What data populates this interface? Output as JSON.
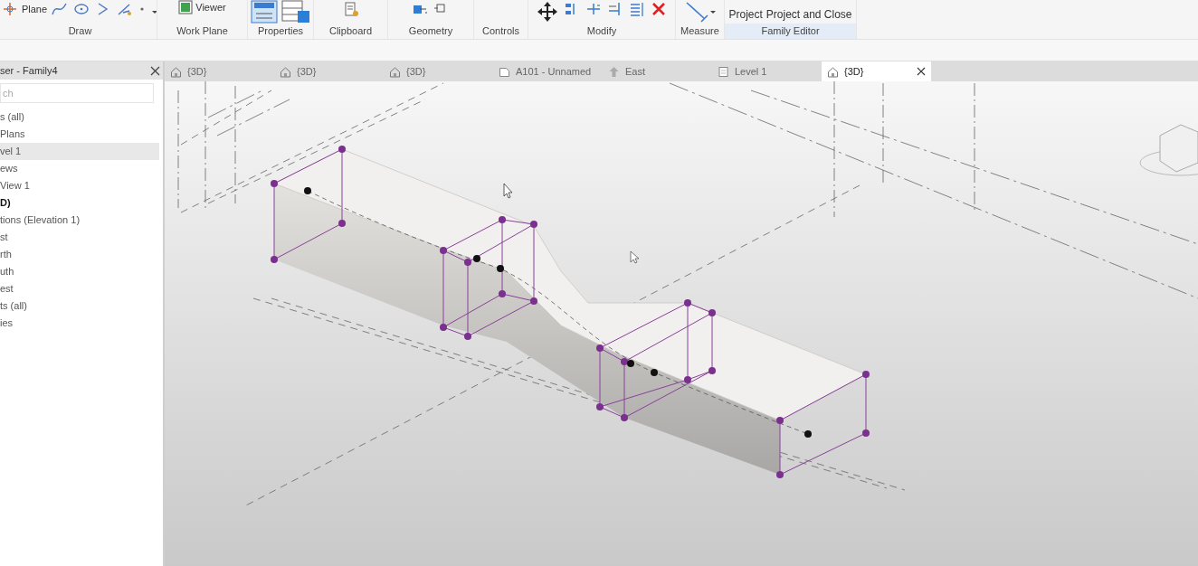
{
  "ribbon": {
    "groups": [
      {
        "label": "Draw",
        "tools": [
          {
            "kind": "plane",
            "label": "Plane"
          },
          {
            "kind": "spline"
          },
          {
            "kind": "ellipse"
          },
          {
            "kind": "arc"
          },
          {
            "kind": "pick"
          },
          {
            "kind": "point"
          },
          {
            "kind": "more"
          }
        ]
      },
      {
        "label": "Work Plane",
        "tools": [
          {
            "kind": "viewer",
            "label": "Viewer"
          }
        ]
      },
      {
        "label": "Properties",
        "tools": [
          {
            "kind": "properties"
          },
          {
            "kind": "types"
          }
        ]
      },
      {
        "label": "Clipboard",
        "tools": [
          {
            "kind": "match"
          }
        ]
      },
      {
        "label": "Geometry",
        "tools": [
          {
            "kind": "join"
          },
          {
            "kind": "cut"
          }
        ]
      },
      {
        "label": "Controls"
      },
      {
        "label": "Modify",
        "tools": [
          {
            "kind": "move"
          },
          {
            "kind": "align"
          },
          {
            "kind": "split"
          },
          {
            "kind": "trim"
          },
          {
            "kind": "array"
          },
          {
            "kind": "delete"
          }
        ]
      },
      {
        "label": "Measure",
        "tools": [
          {
            "kind": "measure"
          }
        ]
      },
      {
        "label": "Family Editor",
        "tools": [
          {
            "kind": "text",
            "label": "Project"
          },
          {
            "kind": "text",
            "label": "Project and Close"
          }
        ]
      }
    ]
  },
  "browser": {
    "title": "ser - Family4",
    "search": {
      "placeholder": "ch"
    },
    "items": [
      {
        "label": "s (all)",
        "selected": false,
        "bold": false
      },
      {
        "label": "Plans",
        "selected": false,
        "bold": false
      },
      {
        "label": "vel 1",
        "selected": true,
        "bold": false
      },
      {
        "label": "ews",
        "selected": false,
        "bold": false
      },
      {
        "label": "View 1",
        "selected": false,
        "bold": false
      },
      {
        "label": "D)",
        "selected": false,
        "bold": true
      },
      {
        "label": "tions (Elevation 1)",
        "selected": false,
        "bold": false
      },
      {
        "label": "st",
        "selected": false,
        "bold": false
      },
      {
        "label": "rth",
        "selected": false,
        "bold": false
      },
      {
        "label": "uth",
        "selected": false,
        "bold": false
      },
      {
        "label": "est",
        "selected": false,
        "bold": false
      },
      {
        "label": "ts (all)",
        "selected": false,
        "bold": false
      },
      {
        "label": "ies",
        "selected": false,
        "bold": false
      }
    ]
  },
  "view_tabs": [
    {
      "kind": "model",
      "label": "{3D}",
      "selected": false
    },
    {
      "kind": "model",
      "label": "{3D}",
      "selected": false
    },
    {
      "kind": "model",
      "label": "{3D}",
      "selected": false
    },
    {
      "kind": "sheet",
      "label": "A101 - Unnamed",
      "selected": false
    },
    {
      "kind": "elevation",
      "label": "East",
      "selected": false
    },
    {
      "kind": "plan",
      "label": "Level 1",
      "selected": false
    },
    {
      "kind": "model",
      "label": "{3D}",
      "selected": true
    }
  ]
}
